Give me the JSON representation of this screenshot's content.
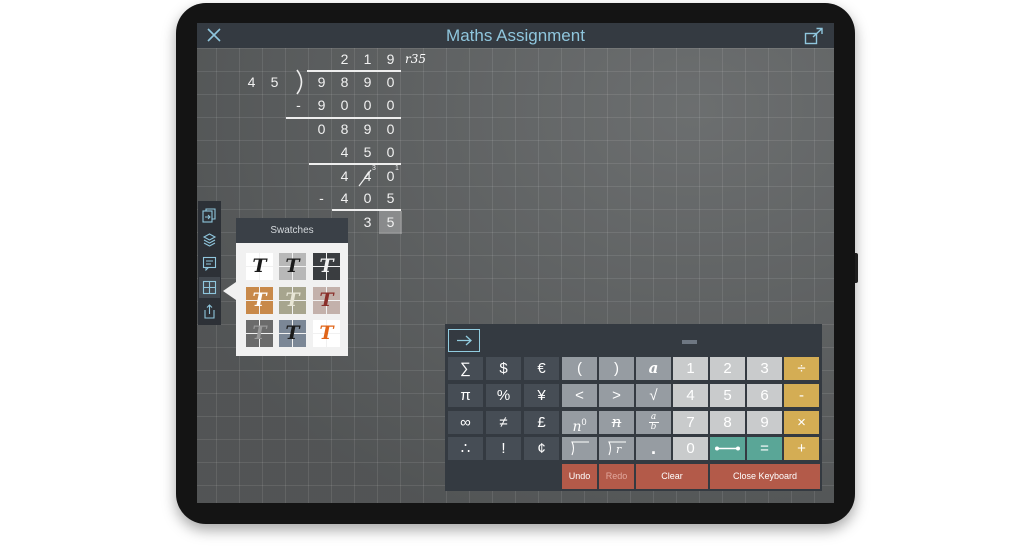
{
  "app": {
    "title": "Maths Assignment",
    "close_icon": "close-icon",
    "share_icon": "share-icon"
  },
  "division": {
    "quotient": [
      "2",
      "1",
      "9"
    ],
    "remainder_label": "r35",
    "divisor": [
      "4",
      "5"
    ],
    "dividend": [
      "9",
      "8",
      "9",
      "0"
    ],
    "rows": [
      [
        "-",
        "9",
        "0",
        "0",
        "0"
      ],
      [
        "0",
        "8",
        "9",
        "0"
      ],
      [
        "4",
        "5",
        "0"
      ],
      [
        "4",
        "4",
        "0"
      ],
      [
        "-",
        "4",
        "0",
        "5"
      ],
      [
        "3",
        "5"
      ]
    ],
    "superscripts": [
      "3",
      "1"
    ]
  },
  "sidebar": {
    "icons": [
      "pages-icon",
      "layers-icon",
      "notes-icon",
      "grid-icon",
      "export-icon"
    ],
    "active": "grid-icon"
  },
  "swatches": {
    "title": "Swatches",
    "glyph": "T",
    "items": [
      {
        "bg": [
          "#ffffff",
          "#ffffff",
          "#ffffff",
          "#ffffff"
        ],
        "fg": "#1a1a1a"
      },
      {
        "bg": [
          "#b8b8b8",
          "#b8b8b8",
          "#b8b8b8",
          "#b8b8b8"
        ],
        "fg": "#1a1a1a"
      },
      {
        "bg": [
          "#3a3d40",
          "#3a3d40",
          "#3a3d40",
          "#3a3d40"
        ],
        "fg": "#f2f2f2"
      },
      {
        "bg": [
          "#c8894a",
          "#c8894a",
          "#c8894a",
          "#c8894a"
        ],
        "fg": "#ffffff"
      },
      {
        "bg": [
          "#a7a58e",
          "#a7a58e",
          "#a7a58e",
          "#a7a58e"
        ],
        "fg": "#e8e6d6"
      },
      {
        "bg": [
          "#c3b1ab",
          "#c3b1ab",
          "#c3b1ab",
          "#c3b1ab"
        ],
        "fg": "#8a2f2a"
      },
      {
        "bg": [
          "#6b6b6b",
          "#6b6b6b",
          "#6b6b6b",
          "#6b6b6b"
        ],
        "fg": "#9a9a9a"
      },
      {
        "bg": [
          "#7b8796",
          "#7b8796",
          "#7b8796",
          "#7b8796"
        ],
        "fg": "#1a1a1a"
      },
      {
        "bg": [
          "#ffffff",
          "#ffffff",
          "#ffffff",
          "#ffffff"
        ],
        "fg": "#e0651a"
      }
    ]
  },
  "keyboard": {
    "go_icon": "arrow-right-icon",
    "rows": [
      [
        "∑",
        "$",
        "€",
        "(",
        ")",
        "a",
        "1",
        "2",
        "3",
        "÷"
      ],
      [
        "π",
        "%",
        "¥",
        "<",
        ">",
        "√",
        "4",
        "5",
        "6",
        "-"
      ],
      [
        "∞",
        "≠",
        "£",
        "n0",
        "n/",
        "a/b",
        "7",
        "8",
        "9",
        "×"
      ],
      [
        "∴",
        "!",
        "¢",
        "root",
        "nroot",
        ".",
        "0",
        "segment",
        "=",
        "+"
      ]
    ],
    "fraction": {
      "num": "a",
      "den": "b"
    },
    "power_base": "n",
    "power_exp": "0",
    "root_var": "r",
    "undo_label": "Undo",
    "redo_label": "Redo",
    "clear_label": "Clear",
    "close_label": "Close Keyboard"
  },
  "colors": {
    "title": "#8fc6dd",
    "topbar": "#343a41",
    "operator_key": "#d4ad54",
    "equals_key": "#5aa697",
    "action_key": "#b35a49"
  }
}
